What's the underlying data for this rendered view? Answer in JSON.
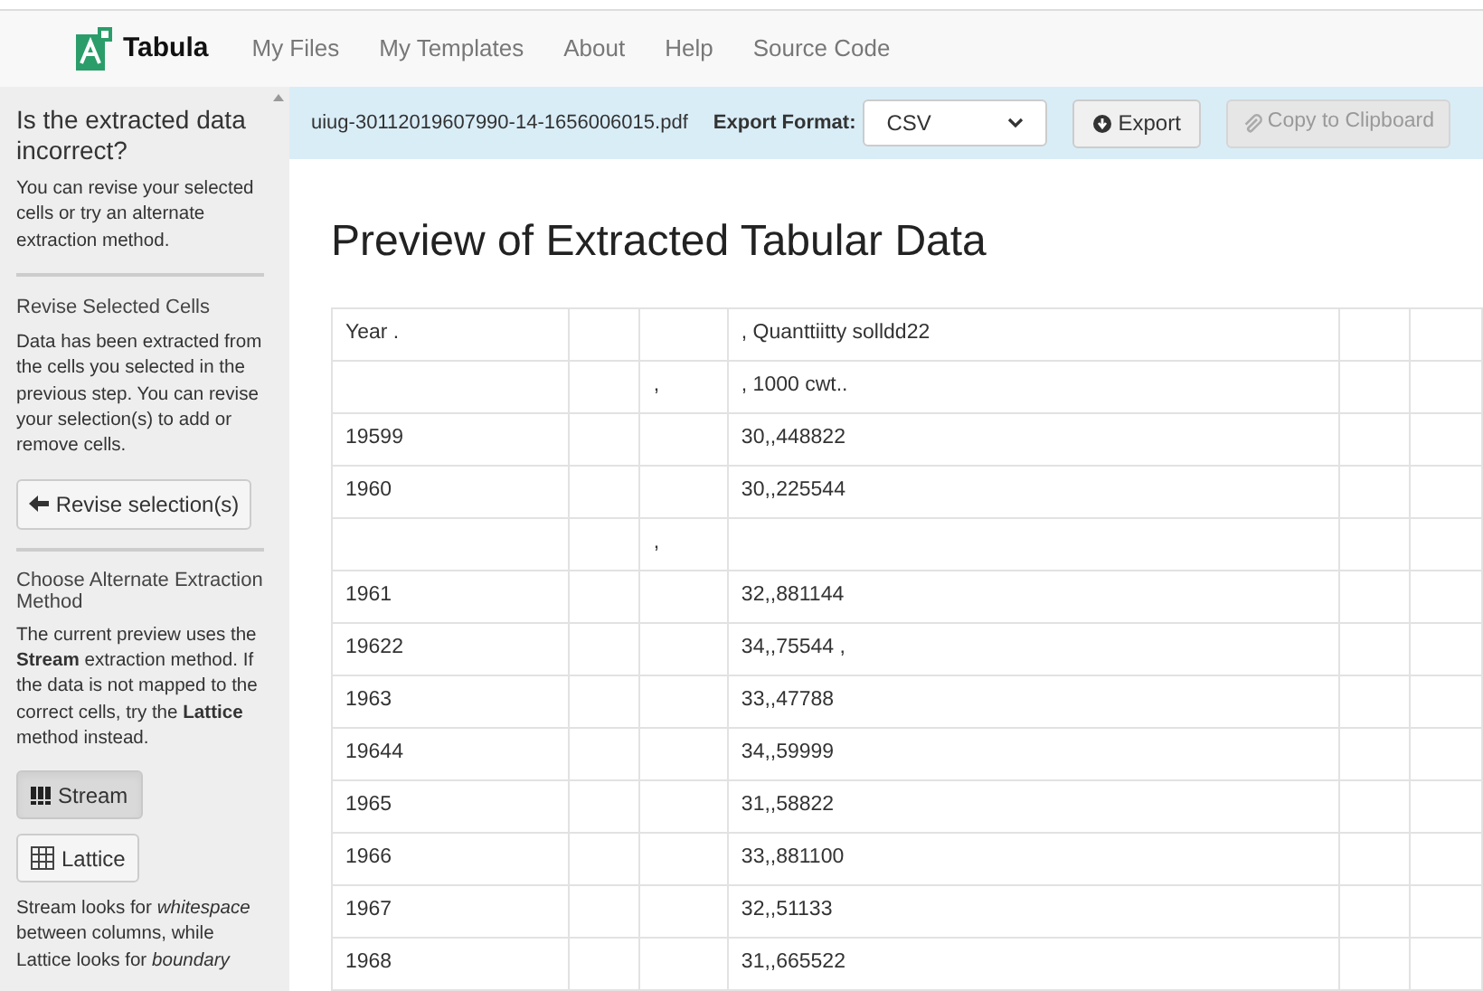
{
  "app": {
    "name": "Tabula"
  },
  "nav": [
    "My Files",
    "My Templates",
    "About",
    "Help",
    "Source Code"
  ],
  "sidebar": {
    "title": "Is the extracted data incorrect?",
    "intro": "You can revise your selected cells or try an alternate extraction method.",
    "revise": {
      "heading": "Revise Selected Cells",
      "text": "Data has been extracted from the cells you selected in the previous step. You can revise your selection(s) to add or remove cells.",
      "button": "Revise selection(s)"
    },
    "alternate": {
      "heading": "Choose Alternate Extraction Method",
      "text": "The current preview uses the **Stream** extraction method. If the data is not mapped to the correct cells, try the **Lattice** method instead.",
      "methods": [
        {
          "label": "Stream",
          "kind": "stream",
          "selected": true
        },
        {
          "label": "Lattice",
          "kind": "lattice",
          "selected": false
        }
      ],
      "note": "Stream looks for *whitespace* between columns, while Lattice looks for *boundary*"
    }
  },
  "toolbar": {
    "filename": "uiug-30112019607990-14-1656006015.pdf",
    "export_label": "Export Format:",
    "format": "CSV",
    "export_button": "Export",
    "copy_button": {
      "label": "Copy to Clipboard",
      "disabled": true
    }
  },
  "preview": {
    "title": "Preview of Extracted Tabular Data",
    "rows": [
      {
        "column_1": "Year .",
        "column_4": ", Quanttiitty solldd22"
      },
      {
        "column_3": ",",
        "column_4": ", 1000 cwt.."
      },
      {
        "column_1": "19599",
        "column_4": "30,,448822"
      },
      {
        "column_1": "1960",
        "column_4": "30,,225544"
      },
      {
        "column_3": ","
      },
      {
        "column_1": "1961",
        "column_4": "32,,881144"
      },
      {
        "column_1": "19622",
        "column_4": "34,,75544 ,"
      },
      {
        "column_1": "1963",
        "column_4": "33,,47788"
      },
      {
        "column_1": "19644",
        "column_4": "34,,59999"
      },
      {
        "column_1": "1965",
        "column_4": "31,,58822"
      },
      {
        "column_1": "1966",
        "column_4": "33,,881100"
      },
      {
        "column_1": "1967",
        "column_4": "32,,51133"
      },
      {
        "column_1": "1968",
        "column_4": "31,,665522"
      }
    ]
  }
}
